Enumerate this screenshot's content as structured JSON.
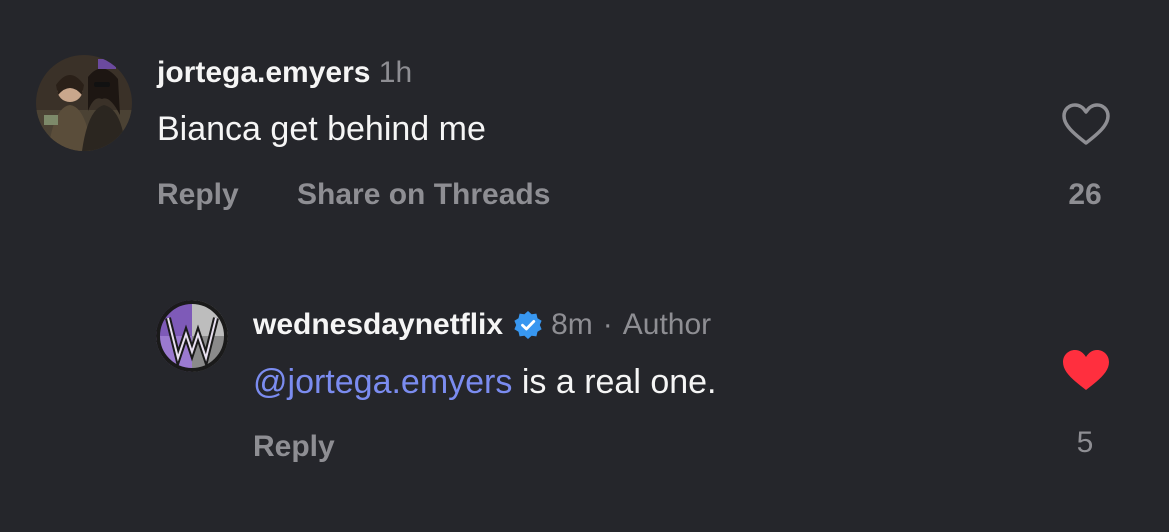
{
  "comments": [
    {
      "username": "jortega.emyers",
      "time": "1h",
      "text": "Bianca get behind me",
      "actions": {
        "reply": "Reply",
        "share": "Share on Threads"
      },
      "likes": "26",
      "liked": false
    },
    {
      "username": "wednesdaynetflix",
      "verified": true,
      "time": "8m",
      "separator": "·",
      "role": "Author",
      "mention": "@jortega.emyers",
      "text": " is a real one.",
      "actions": {
        "reply": "Reply"
      },
      "likes": "5",
      "liked": true
    }
  ],
  "colors": {
    "background": "#25262b",
    "text": "#f5f5f5",
    "muted": "#8e8e93",
    "mention": "#7b8cf0",
    "like_active": "#ff2f3e",
    "verified": "#3897f0"
  },
  "icons": {
    "like": "heart-outline-icon",
    "liked": "heart-filled-icon",
    "verified": "verified-badge-icon"
  }
}
